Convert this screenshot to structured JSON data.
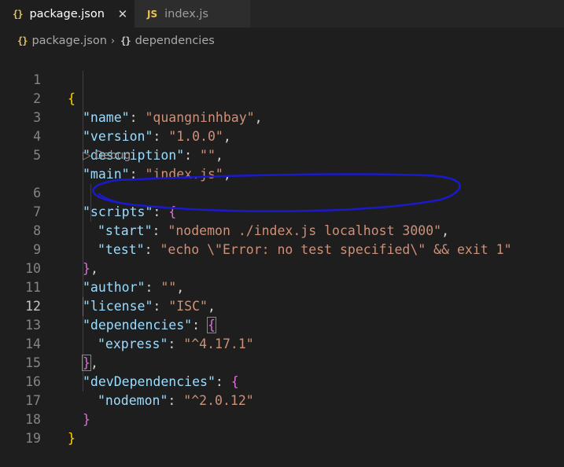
{
  "tabs": [
    {
      "icon": "{}",
      "label": "package.json",
      "close": "✕",
      "active": true
    },
    {
      "icon": "JS",
      "label": "index.js",
      "active": false
    }
  ],
  "breadcrumb": {
    "icon1": "{}",
    "item1": "package.json",
    "sep": "›",
    "icon2": "{}",
    "item2": "dependencies"
  },
  "codelens": "▷ Debug",
  "line_numbers": [
    "1",
    "2",
    "3",
    "4",
    "5",
    "6",
    "7",
    "8",
    "9",
    "10",
    "11",
    "12",
    "13",
    "14",
    "15",
    "16",
    "17",
    "18",
    "19"
  ],
  "current_line": "12",
  "code": {
    "l1": {
      "b": "{"
    },
    "l2": {
      "k": "\"name\"",
      "c": ":",
      "v": "\"quangninhbay\"",
      "e": ","
    },
    "l3": {
      "k": "\"version\"",
      "c": ":",
      "v": "\"1.0.0\"",
      "e": ","
    },
    "l4": {
      "k": "\"description\"",
      "c": ":",
      "v": "\"\"",
      "e": ","
    },
    "l5": {
      "k": "\"main\"",
      "c": ":",
      "v": "\"index.js\"",
      "e": ","
    },
    "l6": {
      "k": "\"scripts\"",
      "c": ":",
      "b": "{"
    },
    "l7": {
      "k": "\"start\"",
      "c": ":",
      "v": "\"nodemon ./index.js localhost 3000\"",
      "e": ","
    },
    "l8": {
      "k": "\"test\"",
      "c": ":",
      "v": "\"echo \\\"Error: no test specified\\\" && exit 1\""
    },
    "l9": {
      "b": "}",
      "e": ","
    },
    "l10": {
      "k": "\"author\"",
      "c": ":",
      "v": "\"\"",
      "e": ","
    },
    "l11": {
      "k": "\"license\"",
      "c": ":",
      "v": "\"ISC\"",
      "e": ","
    },
    "l12": {
      "k": "\"dependencies\"",
      "c": ":",
      "b": "{"
    },
    "l13": {
      "k": "\"express\"",
      "c": ":",
      "v": "\"^4.17.1\""
    },
    "l14": {
      "b": "}",
      "e": ","
    },
    "l15": {
      "k": "\"devDependencies\"",
      "c": ":",
      "b": "{"
    },
    "l16": {
      "k": "\"nodemon\"",
      "c": ":",
      "v": "\"^2.0.12\""
    },
    "l17": {
      "b": "}"
    },
    "l18": {
      "b": "}"
    },
    "l19": {}
  },
  "annotation": {
    "color": "#1a1acc",
    "target_line": "7"
  },
  "colors": {
    "key": "#9cdcfe",
    "string": "#ce9178",
    "bracket_level1": "#ffd700",
    "bracket_level2": "#da70d6",
    "bracket_level3": "#179fff",
    "background": "#1e1e1e"
  }
}
